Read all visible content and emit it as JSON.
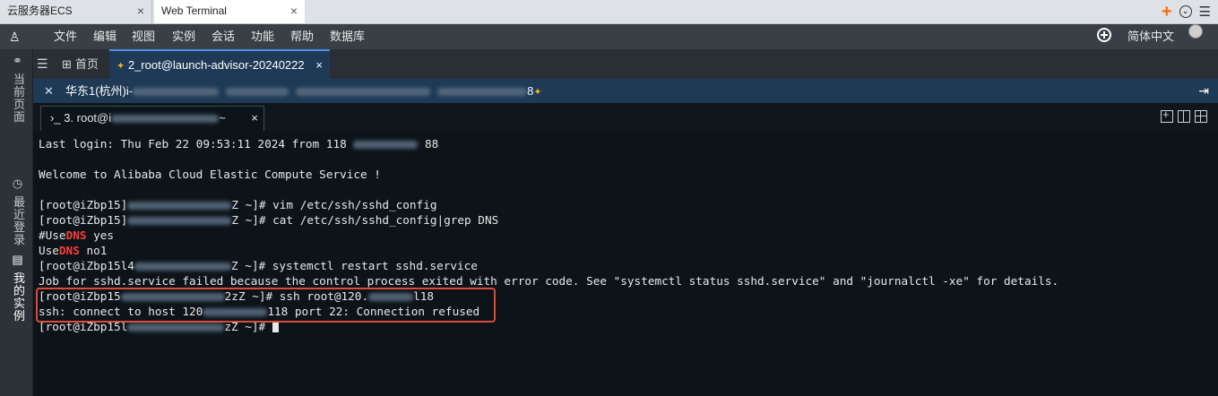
{
  "browser": {
    "tabs": [
      {
        "label": "云服务器ECS",
        "active": false
      },
      {
        "label": "Web Terminal",
        "active": true
      }
    ],
    "close_glyph": "×"
  },
  "menubar": {
    "items": [
      "文件",
      "编辑",
      "视图",
      "实例",
      "会话",
      "功能",
      "帮助",
      "数据库"
    ],
    "language": "简体中文"
  },
  "sidebar": {
    "items": [
      {
        "label": "当前页面",
        "icon": "link-icon"
      },
      {
        "label": "最近登录",
        "icon": "clock-icon"
      },
      {
        "label": "我的实例",
        "icon": "server-icon"
      }
    ]
  },
  "tabbar": {
    "home": "首页",
    "session": "2_root@launch-advisor-20240222"
  },
  "region": {
    "prefix": "华东1(杭州)i-",
    "suffix": "8"
  },
  "terminal_tab": {
    "prefix": "3. root@i",
    "suffix": "~"
  },
  "terminal": {
    "lines": {
      "l1": "Last login: Thu Feb 22 09:53:11 2024 from 118",
      "l1b": "88",
      "l2": "Welcome to Alibaba Cloud Elastic Compute Service !",
      "l3a": "[root@iZbp15]",
      "l3b": "Z ~]# vim /etc/ssh/sshd_config",
      "l4a": "[root@iZbp15]",
      "l4b": "Z ~]# cat /etc/ssh/sshd_config|grep DNS",
      "l5a": "#Use",
      "l5b": "DNS",
      "l5c": " yes",
      "l6a": "Use",
      "l6b": "DNS",
      "l6c": " no1",
      "l7a": "[root@iZbp15l4",
      "l7b": "Z ~]# systemctl restart sshd.service",
      "l8": "Job for sshd.service failed because the control process exited with error code. See \"systemctl status sshd.service\" and \"journalctl -xe\" for details.",
      "l9a": "[root@iZbp15",
      "l9b": "2zZ ~]# ssh root@120.",
      "l9c": "l18",
      "l10a": "ssh: connect to host 120",
      "l10b": "118 port 22: Connection refused",
      "l11a": "[root@iZbp15l",
      "l11b": "zZ ~]# "
    }
  },
  "colors": {
    "highlight_box": "#e04a36",
    "accent": "#ff6a00"
  }
}
